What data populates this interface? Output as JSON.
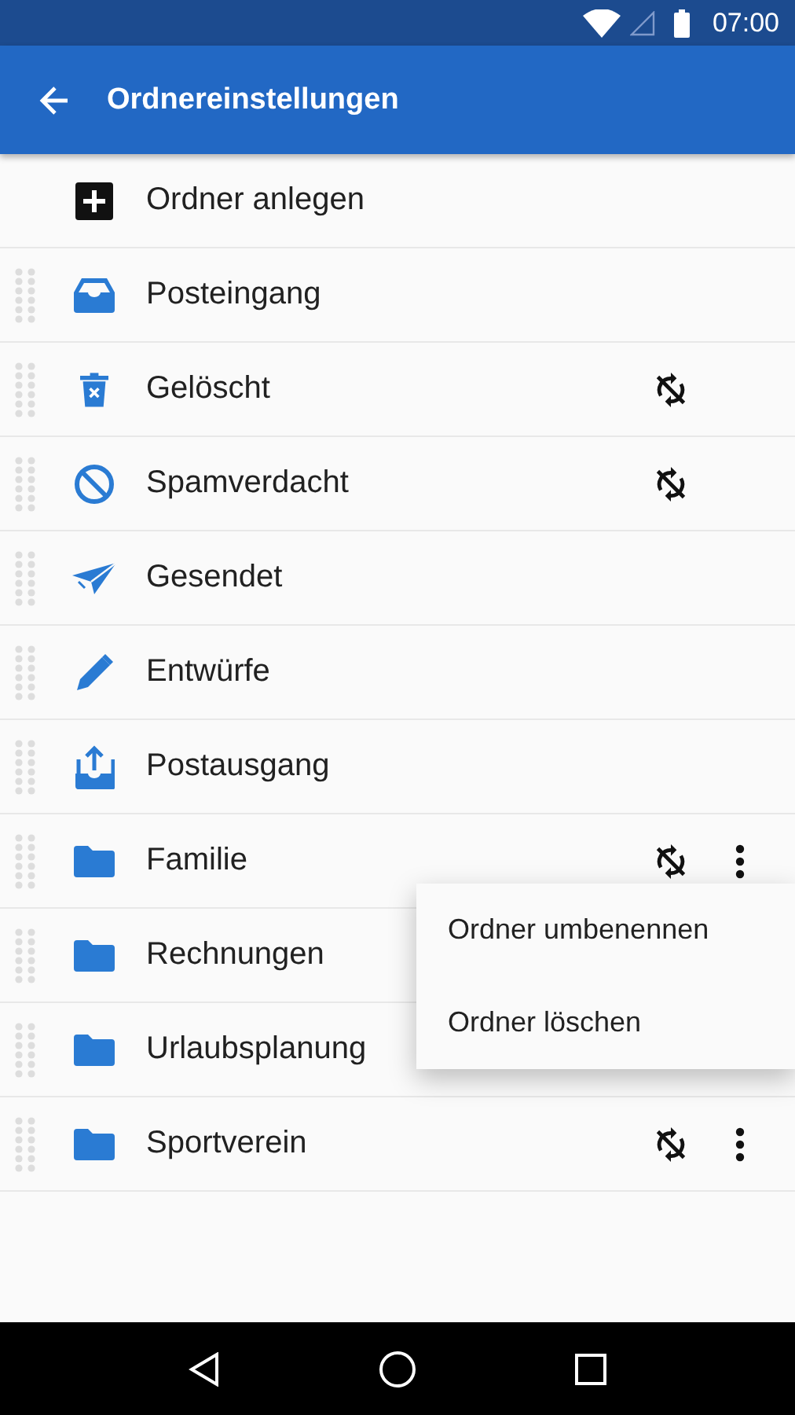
{
  "status_bar": {
    "time": "07:00"
  },
  "app_bar": {
    "title": "Ordnereinstellungen"
  },
  "rows": [
    {
      "kind": "add",
      "label": "Ordner anlegen",
      "sync_off": false,
      "menu": false
    },
    {
      "kind": "inbox",
      "label": "Posteingang",
      "sync_off": false,
      "menu": false
    },
    {
      "kind": "trash",
      "label": "Gelöscht",
      "sync_off": true,
      "menu": false
    },
    {
      "kind": "spam",
      "label": "Spamverdacht",
      "sync_off": true,
      "menu": false
    },
    {
      "kind": "sent",
      "label": "Gesendet",
      "sync_off": false,
      "menu": false
    },
    {
      "kind": "drafts",
      "label": "Entwürfe",
      "sync_off": false,
      "menu": false
    },
    {
      "kind": "outbox",
      "label": "Postausgang",
      "sync_off": false,
      "menu": false
    },
    {
      "kind": "folder",
      "label": "Familie",
      "sync_off": true,
      "menu": true
    },
    {
      "kind": "folder",
      "label": "Rechnungen",
      "sync_off": false,
      "menu": false
    },
    {
      "kind": "folder",
      "label": "Urlaubsplanung",
      "sync_off": false,
      "menu": false
    },
    {
      "kind": "folder",
      "label": "Sportverein",
      "sync_off": true,
      "menu": true
    }
  ],
  "popup_menu": {
    "items": [
      "Ordner umbenennen",
      "Ordner löschen"
    ]
  }
}
